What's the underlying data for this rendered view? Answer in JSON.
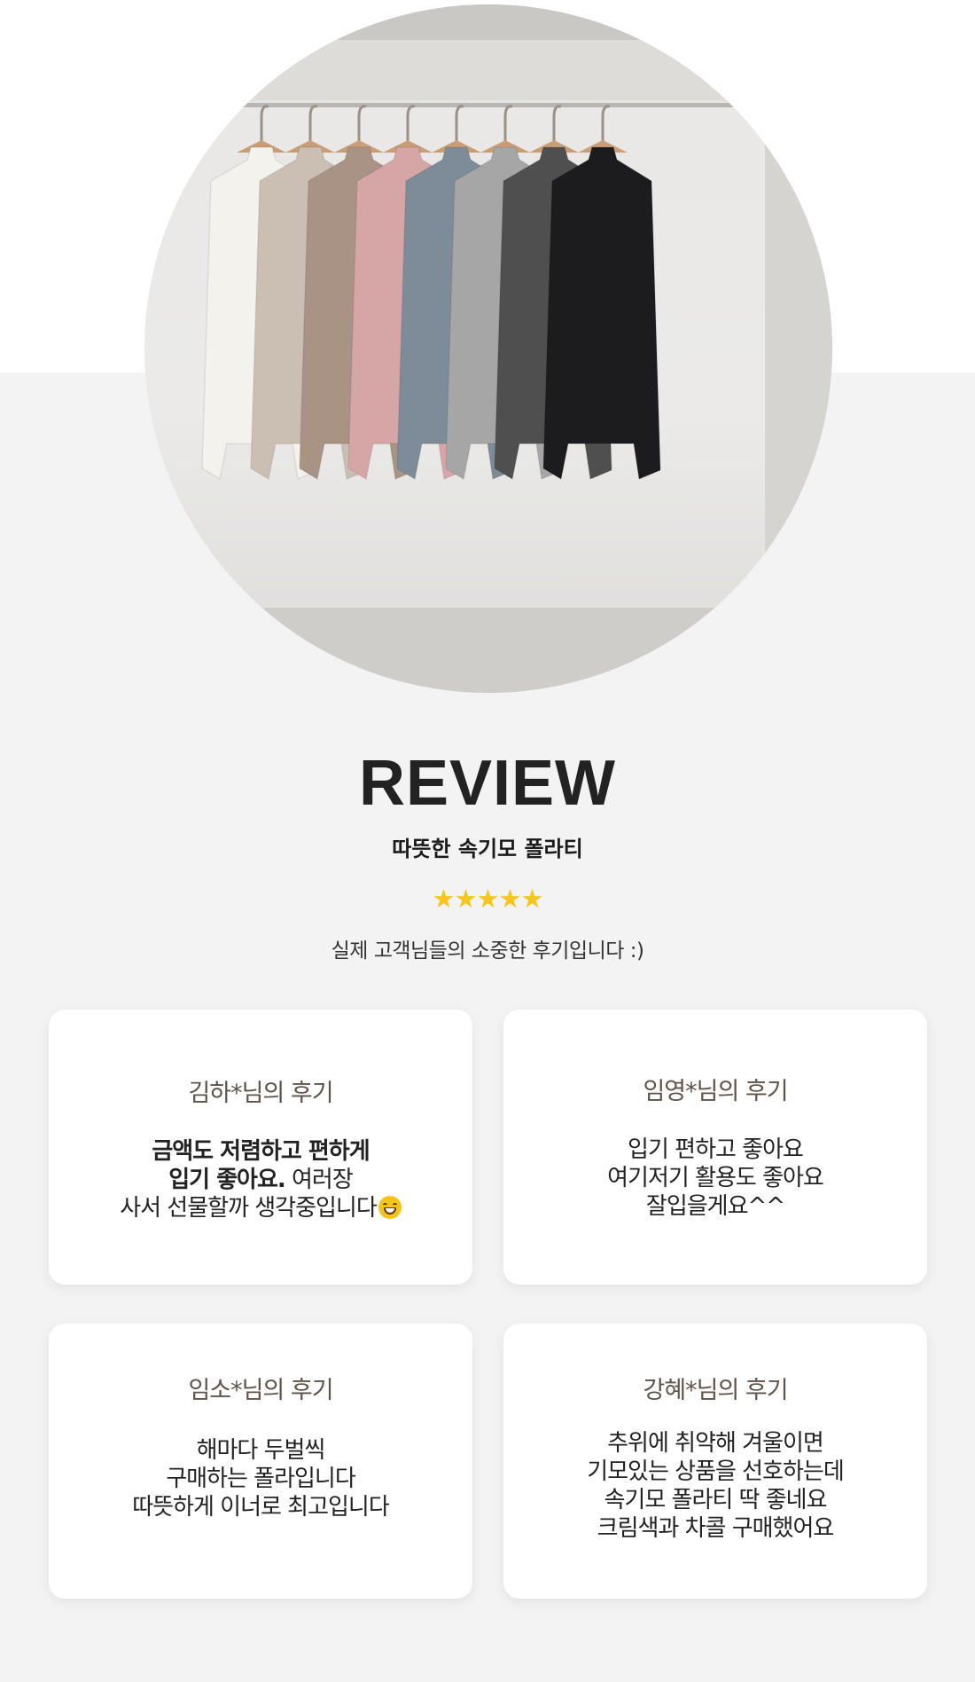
{
  "hero": {
    "image_alt": "",
    "shirt_colors": [
      "#f4f2ed",
      "#cbbfb3",
      "#a99384",
      "#d6a6a7",
      "#7d8c98",
      "#a6a6a6",
      "#4f4f4f",
      "#1c1c1e"
    ]
  },
  "header": {
    "title": "REVIEW",
    "subtitle": "따뜻한 속기모 폴라티",
    "stars": "★★★★★",
    "rating": 5,
    "description": "실제 고객님들의 소중한 후기입니다 :)"
  },
  "reviews": [
    {
      "author": "김하*님의 후기",
      "lines": [
        "금액도 저렴하고 편하게",
        "입기 좋아요.",
        " 여러장",
        "사서 선물할까 생각중입니다"
      ],
      "emoji": "grinning-face-emoji"
    },
    {
      "author": "임영*님의 후기",
      "lines": [
        "입기 편하고 좋아요",
        "여기저기 활용도 좋아요",
        "잘입을게요^^"
      ]
    },
    {
      "author": "임소*님의 후기",
      "lines": [
        "해마다 두벌씩",
        "구매하는 폴라입니다",
        "따뜻하게 이너로 최고입니다"
      ]
    },
    {
      "author": "강혜*님의 후기",
      "lines": [
        "추위에 취약해 겨울이면",
        "기모있는 상품을 선호하는데",
        "속기모 폴라티 딱 좋네요",
        "크림색과 차콜 구매했어요"
      ]
    }
  ]
}
